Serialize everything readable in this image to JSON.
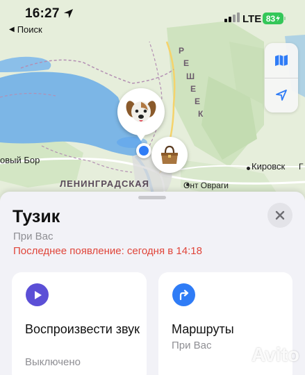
{
  "status_bar": {
    "time": "16:27",
    "back_label": "Поиск",
    "network": "LTE",
    "battery": "83"
  },
  "map": {
    "labels": {
      "left_town": "овый Бор",
      "district": "ЛЕНИНГРАДСКАЯ",
      "kirovsk": "Кировск",
      "ont_ovragi": "Онт Овраги",
      "right_edge": "Г",
      "region_letters": [
        "Р",
        "Е",
        "Ш",
        "Е",
        "Е",
        "К"
      ]
    },
    "pins": [
      "dog-emoji",
      "handbag-emoji"
    ],
    "controls": [
      "map-icon",
      "location-arrow-icon"
    ]
  },
  "item": {
    "name": "Тузик",
    "location": "При Вас",
    "last_seen": "Последнее появление: сегодня в 14:18"
  },
  "actions": [
    {
      "icon": "play-icon",
      "color": "#5b4fd6",
      "title": "Воспроизвести звук",
      "status": "Выключено"
    },
    {
      "icon": "route-arrow-icon",
      "color": "#2f7cf6",
      "title": "Маршруты",
      "status": "При Вас"
    }
  ],
  "watermark": "Avito",
  "colors": {
    "last_seen": "#e0453a",
    "accent_blue": "#2f7cf6",
    "sound_purple": "#5b4fd6",
    "battery_green": "#34c759"
  }
}
